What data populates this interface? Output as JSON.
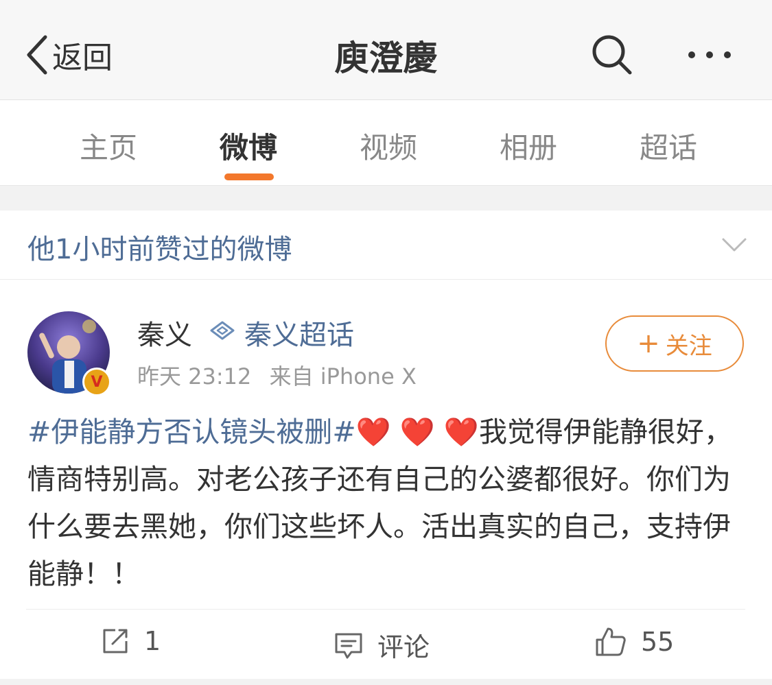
{
  "nav": {
    "back_label": "返回",
    "title": "庾澄慶"
  },
  "tabs": [
    {
      "label": "主页"
    },
    {
      "label": "微博"
    },
    {
      "label": "视频"
    },
    {
      "label": "相册"
    },
    {
      "label": "超话"
    }
  ],
  "active_tab": "微博",
  "liked_section": {
    "text": "他1小时前赞过的微博"
  },
  "post": {
    "username": "秦义",
    "topic_link": "秦义超话",
    "time": "昨天 23:12",
    "source": "来自 iPhone X",
    "follow_label": "关注",
    "hashtag": "#伊能静方否认镜头被删#",
    "hearts": "❤️ ❤️ ❤️",
    "text": "我觉得伊能静很好，情商特别高。对老公孩子还有自己的公婆都很好。你们为什么要去黑她，你们这些坏人。活出真实的自己，支持伊能静！！"
  },
  "actions": {
    "repost_count": "1",
    "comment_label": "评论",
    "like_count": "55"
  },
  "colors": {
    "accent": "#f3782c",
    "link": "#4e6c95",
    "follow": "#e88b3a",
    "heart": "#e0232b"
  }
}
